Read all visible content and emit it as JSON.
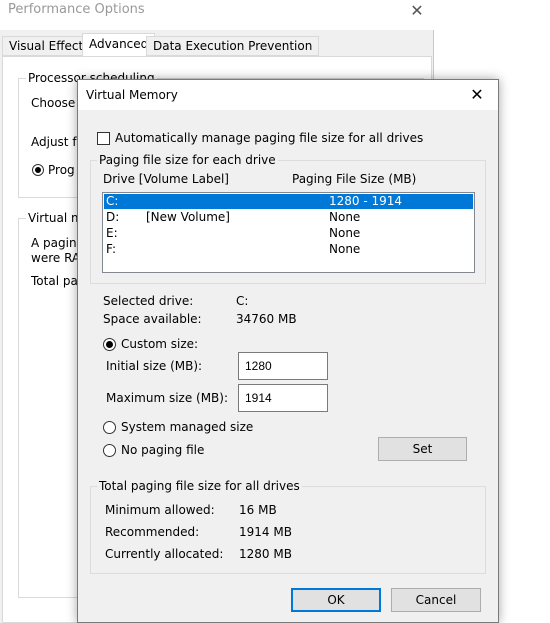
{
  "performance_options": {
    "title": "Performance Options",
    "tabs": [
      {
        "label": "Visual Effects"
      },
      {
        "label": "Advanced"
      },
      {
        "label": "Data Execution Prevention"
      }
    ],
    "processor_group_label": "Processor scheduling",
    "choose_text": "Choose",
    "adjust_text": "Adjust f",
    "programs_radio": "Prog",
    "virtual_memory_group_label": "Virtual m",
    "paging_text_line1": "A pagin",
    "paging_text_line2": "were RA",
    "total_paging_text": "Total pa"
  },
  "virtual_memory": {
    "title": "Virtual Memory",
    "auto_manage_label": "Automatically manage paging file size for all drives",
    "auto_manage_checked": false,
    "paging_group_label": "Paging file size for each drive",
    "col_drive": "Drive  [Volume Label]",
    "col_paging_size": "Paging File Size (MB)",
    "drives": [
      {
        "drive": "C:",
        "label": "",
        "size": "1280 - 1914"
      },
      {
        "drive": "D:",
        "label": "[New Volume]",
        "size": "None"
      },
      {
        "drive": "E:",
        "label": "",
        "size": "None"
      },
      {
        "drive": "F:",
        "label": "",
        "size": "None"
      }
    ],
    "selected_drive_label": "Selected drive:",
    "selected_drive_value": "C:",
    "space_available_label": "Space available:",
    "space_available_value": "34760 MB",
    "custom_size_label": "Custom size:",
    "initial_size_label": "Initial size (MB):",
    "initial_size_value": "1280",
    "maximum_size_label": "Maximum size (MB):",
    "maximum_size_value": "1914",
    "system_managed_label": "System managed size",
    "no_paging_label": "No paging file",
    "set_button": "Set",
    "total_group_label": "Total paging file size for all drives",
    "minimum_allowed_label": "Minimum allowed:",
    "minimum_allowed_value": "16 MB",
    "recommended_label": "Recommended:",
    "recommended_value": "1914 MB",
    "currently_allocated_label": "Currently allocated:",
    "currently_allocated_value": "1280 MB",
    "ok_button": "OK",
    "cancel_button": "Cancel",
    "close_icon": "close-icon",
    "accent_color": "#0078d7"
  }
}
